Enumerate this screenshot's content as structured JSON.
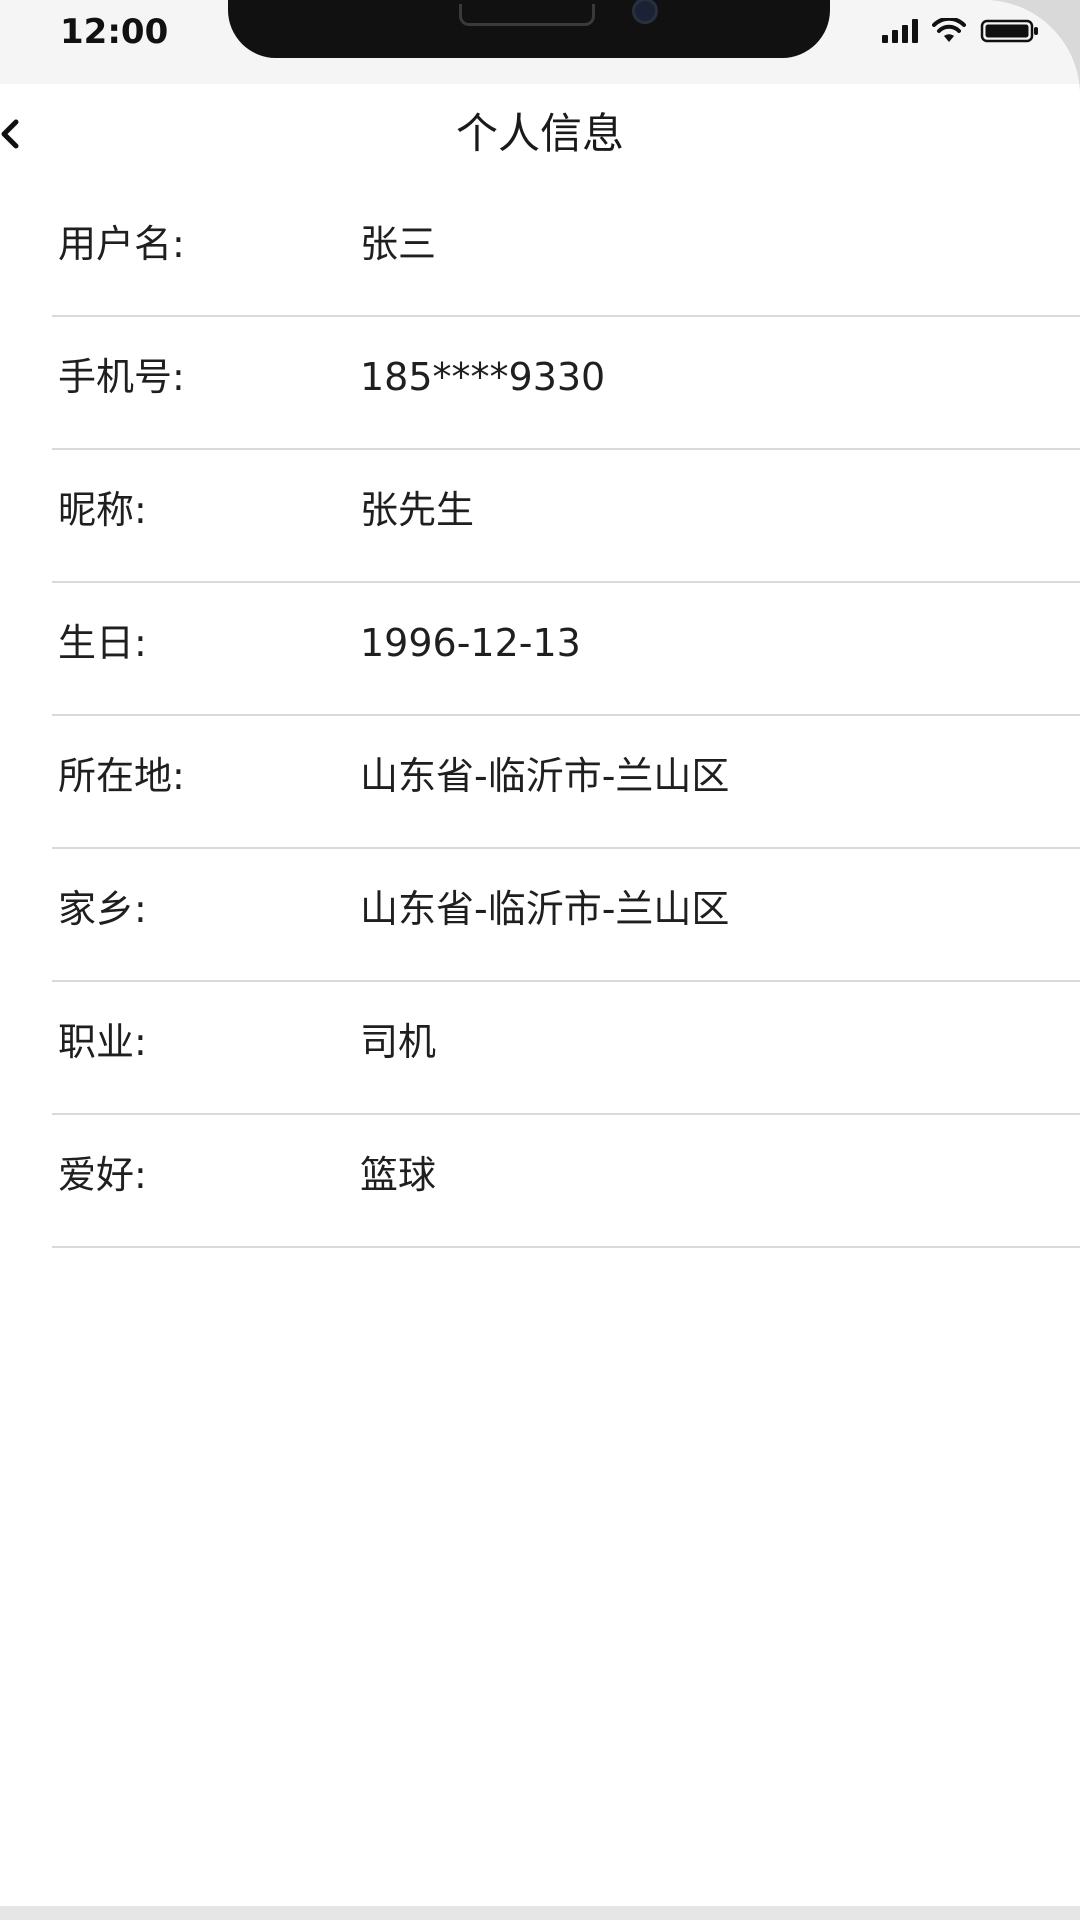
{
  "status_bar": {
    "time": "12:00",
    "icons": [
      "signal-icon",
      "wifi-icon",
      "battery-icon"
    ]
  },
  "header": {
    "title": "个人信息",
    "back_icon": "chevron-left-icon"
  },
  "profile": {
    "rows": [
      {
        "label": "用户名:",
        "value": "张三"
      },
      {
        "label": "手机号:",
        "value": "185****9330"
      },
      {
        "label": "昵称:",
        "value": "张先生"
      },
      {
        "label": "生日:",
        "value": "1996-12-13"
      },
      {
        "label": "所在地:",
        "value": "山东省-临沂市-兰山区"
      },
      {
        "label": "家乡:",
        "value": "山东省-临沂市-兰山区"
      },
      {
        "label": "职业:",
        "value": "司机"
      },
      {
        "label": "爱好:",
        "value": "篮球"
      }
    ]
  },
  "colors": {
    "background": "#ffffff",
    "status_bar_bg": "#f5f5f5",
    "divider": "#d9d9d9",
    "text": "#1f1f1f"
  }
}
